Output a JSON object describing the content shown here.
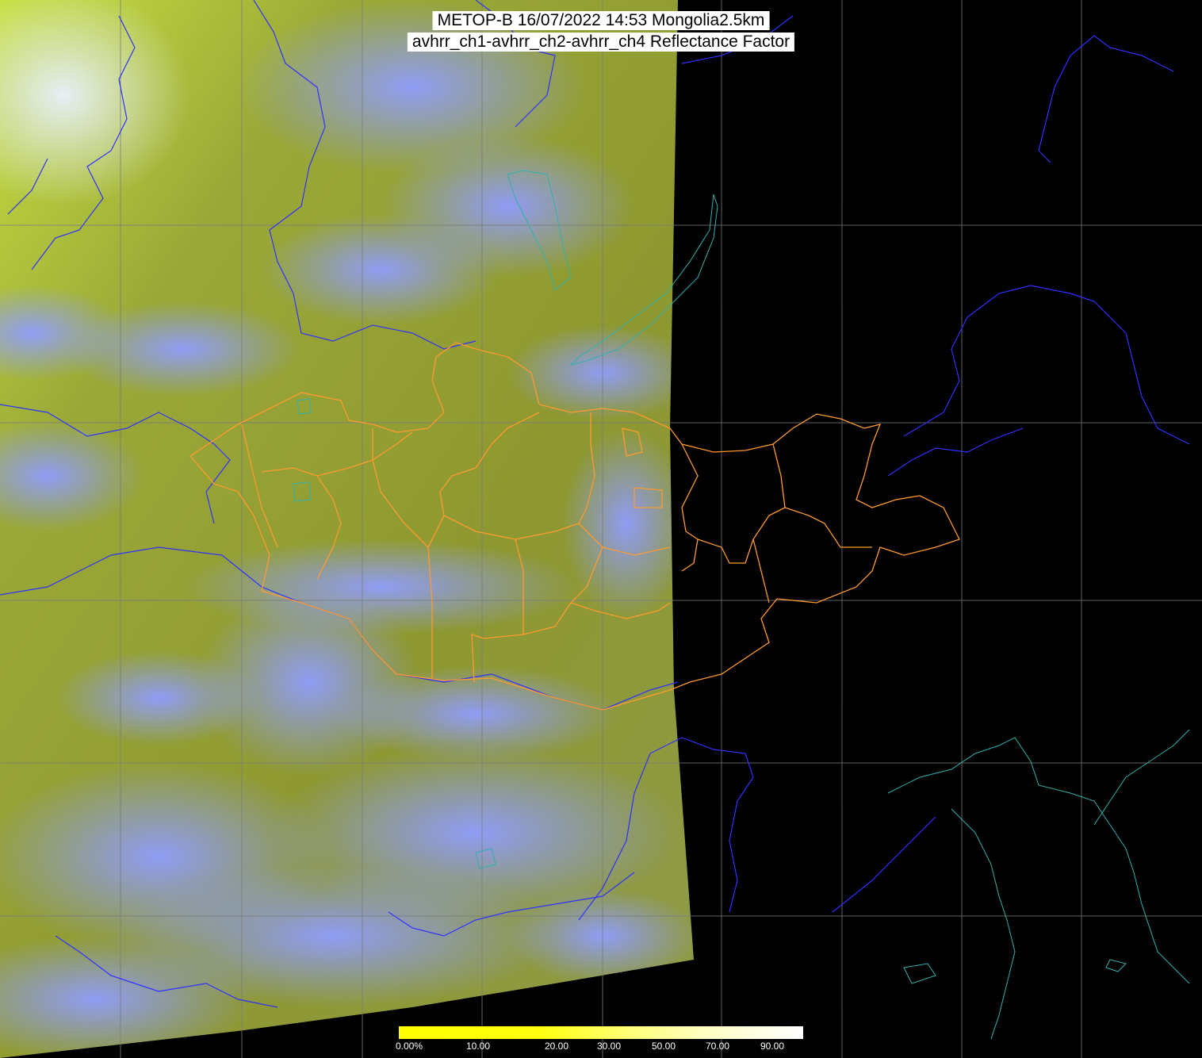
{
  "title": {
    "line1": "METOP-B 16/07/2022 14:53 Mongolia2.5km",
    "line2": "avhrr_ch1-avhrr_ch2-avhrr_ch4 Reflectance Factor"
  },
  "colorbar": {
    "ticks": [
      "0.00%",
      "10.00",
      "20.00",
      "30.00",
      "50.00",
      "70.00",
      "90.00"
    ],
    "colors": [
      "#ffff00",
      "#ffff20",
      "#ffff60",
      "#ffffa0",
      "#ffffd0",
      "#ffffff"
    ]
  },
  "colors": {
    "background": "#000000",
    "land_surface": "#8f9a30",
    "cloud": "#8f9bff",
    "grid": "#7a7a7a",
    "country_border": "#3030ff",
    "admin_border": "#ff9a30",
    "coastline": "#30b0b0"
  }
}
